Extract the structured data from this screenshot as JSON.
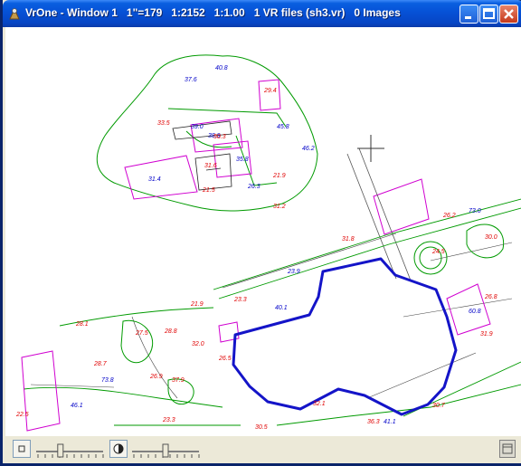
{
  "window": {
    "title": "VrOne - Window 1   1\"=179   1:2152   1:1.00   1 VR files (sh3.vr)   0 Images"
  },
  "icons": {
    "app": "vrone-app-icon",
    "minimize": "minimize-icon",
    "maximize": "maximize-icon",
    "close": "close-icon",
    "point_mode": "point-mode-icon",
    "contrast": "contrast-icon",
    "corner": "window-corner-icon"
  },
  "colors": {
    "titlebar": "#0653d8",
    "close_button": "#c5391b",
    "map_red": "#e00000",
    "map_green": "#009a00",
    "map_blue": "#0000c8",
    "map_magenta": "#d000d0",
    "boundary": "#1414c8"
  },
  "map": {
    "labels": [
      "37.6",
      "40.8",
      "29.4",
      "33.5",
      "39.0",
      "38.9",
      "50.3",
      "45.8",
      "46.2",
      "31.6",
      "35.8",
      "21.9",
      "31.4",
      "21.5",
      "26.3",
      "31.2",
      "31.8",
      "24.5",
      "73.0",
      "26.2",
      "30.0",
      "23.3",
      "40.1",
      "21.9",
      "26.8",
      "28.1",
      "27.5",
      "28.8",
      "32.0",
      "26.5",
      "28.7",
      "37.9",
      "26.9",
      "73.8",
      "22.5",
      "23.3",
      "31.9",
      "46.1",
      "32.1",
      "30.7",
      "23.9",
      "36.3",
      "60.8",
      "30.5",
      "41.1"
    ]
  },
  "status_bar": {
    "slider1_level": 0.35,
    "slider2_level": 0.5
  }
}
